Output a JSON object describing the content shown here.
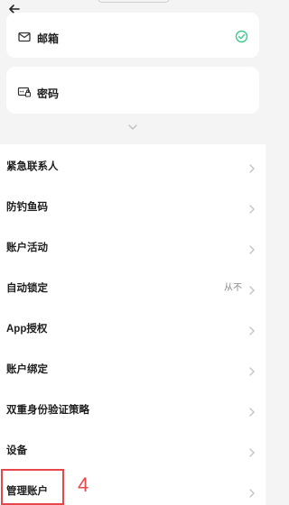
{
  "header": {
    "back_icon": "back-arrow-icon"
  },
  "credentials": {
    "email": {
      "label": "邮箱",
      "icon": "mail-icon",
      "status_icon": "check-circle-icon",
      "status_color": "#3ec98f"
    },
    "password": {
      "label": "密码",
      "icon": "password-key-icon"
    },
    "expand_icon": "chevron-down-icon"
  },
  "settings": {
    "items": [
      {
        "label": "紧急联系人"
      },
      {
        "label": "防钓鱼码"
      },
      {
        "label": "账户活动"
      },
      {
        "label": "自动锁定",
        "value": "从不"
      },
      {
        "label": "App授权"
      },
      {
        "label": "账户绑定"
      },
      {
        "label": "双重身份验证策略"
      },
      {
        "label": "设备"
      },
      {
        "label": "管理账户"
      }
    ]
  },
  "annotation": {
    "step_number": "4",
    "color": "#e8474a"
  }
}
